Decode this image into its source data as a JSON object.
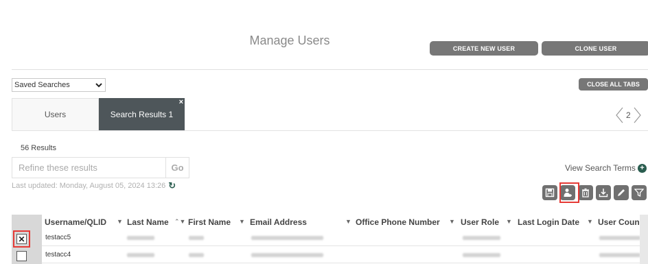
{
  "header": {
    "title": "Manage Users",
    "create_new_user": "CREATE NEW USER",
    "clone_user": "CLONE USER"
  },
  "saved_searches": {
    "selected": "Saved Searches"
  },
  "close_all_tabs": "CLOSE ALL TABS",
  "tabs": [
    {
      "label": "Users",
      "active": false
    },
    {
      "label": "Search Results 1",
      "active": true,
      "close": "×"
    }
  ],
  "pager": {
    "page": "2"
  },
  "results": {
    "count_text": "56 Results",
    "refine_placeholder": "Refine these results",
    "go_label": "Go",
    "view_search_terms": "View Search Terms",
    "last_updated": "Last updated: Monday, August 05, 2024 13:26"
  },
  "toolbar": {
    "icons": [
      "save-icon",
      "add-user-icon",
      "delete-icon",
      "download-icon",
      "edit-icon",
      "filter-icon"
    ]
  },
  "grid": {
    "columns": [
      "Username/QLID",
      "Last Name",
      "First Name",
      "Email Address",
      "Office Phone Number",
      "User Role",
      "Last Login Date",
      "User Coun"
    ],
    "rows": [
      {
        "username": "testacc5",
        "checked": true
      },
      {
        "username": "testacc4",
        "checked": false
      }
    ]
  },
  "colors": {
    "button_gray": "#777777",
    "active_tab": "#4e565a",
    "accent_green": "#2a5d4f",
    "highlight_red": "#e53935"
  }
}
